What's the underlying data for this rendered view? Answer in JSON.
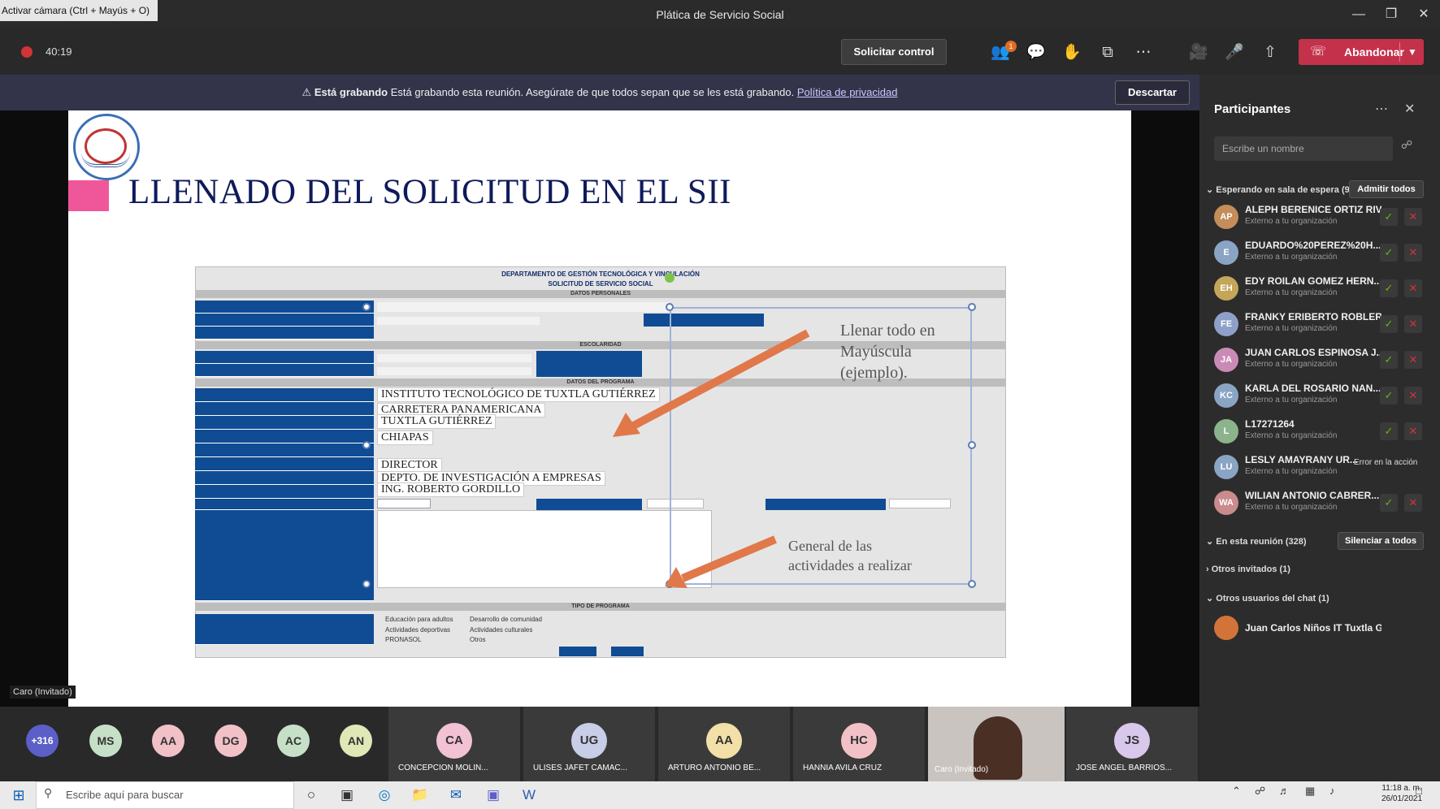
{
  "window": {
    "camera_tooltip": "Activar cámara (Ctrl + Mayús + O)",
    "title": "Plática de Servicio Social",
    "minimize": "—",
    "maximize": "❐",
    "close": "✕"
  },
  "toolbar": {
    "timer": "40:19",
    "request_control": "Solicitar control",
    "notification_count": "1",
    "leave_label": "Abandonar"
  },
  "banner": {
    "bold": "Está grabando",
    "text": " Está grabando esta reunión. Asegúrate de que todos sepan que se les está grabando.",
    "link": "Política de privacidad",
    "discard": "Descartar"
  },
  "slide": {
    "title": "LLENADO DEL SOLICITUD EN EL SII",
    "annotation_1_line1": "Llenar todo en",
    "annotation_1_line2": "Mayúscula",
    "annotation_1_line3": "(ejemplo).",
    "annotation_2_line1": "General de las",
    "annotation_2_line2": "actividades a realizar",
    "form": {
      "header1": "DEPARTAMENTO DE GESTIÓN TECNOLÓGICA Y VINCULACIÓN",
      "header2": "SOLICITUD DE SERVICIO SOCIAL",
      "bar_personal": "DATOS PERSONALES",
      "bar_school": "ESCOLARIDAD",
      "bar_program": "DATOS DEL PROGRAMA",
      "bar_type": "TIPO DE PROGRAMA",
      "val_program_entity": "INSTITUTO TECNOLÓGICO DE TUXTLA GUTIÉRREZ",
      "val_address": "CARRETERA PANAMERICANA",
      "val_city": "TUXTLA GUTIÉRREZ",
      "val_state": "CHIAPAS",
      "val_position": "DIRECTOR",
      "val_dept": "DEPTO. DE INVESTIGACIÓN A EMPRESAS",
      "val_responsible": "ING. ROBERTO GORDILLO",
      "type_opts": [
        "Educación para adultos",
        "Desarrollo de comunidad",
        "Actividades deportivas",
        "Actividades culturales",
        "PRONASOL",
        "Otros"
      ]
    }
  },
  "presenter_tag": "Caro (Invitado)",
  "participants": {
    "title": "Participantes",
    "search_placeholder": "Escribe un nombre",
    "waiting_label": "Esperando en sala de espera (9)",
    "admit_all": "Admitir todos",
    "in_meeting_label": "En esta reunión (328)",
    "mute_all": "Silenciar a todos",
    "other_invited": "Otros invitados (1)",
    "other_chat": "Otros usuarios del chat (1)",
    "external_note": "Externo a tu organización",
    "action_error": "Error en la acción",
    "waiting": [
      {
        "initials": "AP",
        "name": "ALEPH BERENICE ORTIZ RIV...",
        "color": "#c48d5a"
      },
      {
        "initials": "E",
        "name": "EDUARDO%20PEREZ%20H...",
        "color": "#8aa4c4"
      },
      {
        "initials": "EH",
        "name": "EDY ROILAN GOMEZ HERN...",
        "color": "#c4a65a"
      },
      {
        "initials": "FE",
        "name": "FRANKY ERIBERTO ROBLER...",
        "color": "#8ea0c9"
      },
      {
        "initials": "JA",
        "name": "JUAN CARLOS ESPINOSA J...",
        "color": "#c98bb6"
      },
      {
        "initials": "KC",
        "name": "KARLA DEL ROSARIO NAN...",
        "color": "#8aa4c4"
      },
      {
        "initials": "L",
        "name": "L17271264",
        "color": "#8cb48c"
      },
      {
        "initials": "LU",
        "name": "LESLY AMAYRANY UR...",
        "color": "#8aa4c4"
      },
      {
        "initials": "WA",
        "name": "WILIAN ANTONIO CABRER...",
        "color": "#c98b8b"
      }
    ],
    "chat_user": "Juan Carlos Niños IT Tuxtla Gtz"
  },
  "gallery": {
    "overflow": "+316",
    "avatars": [
      {
        "initials": "MS",
        "color": "#c6e0c8"
      },
      {
        "initials": "AA",
        "color": "#f2c1c7"
      },
      {
        "initials": "DG",
        "color": "#f2c1c7"
      },
      {
        "initials": "AC",
        "color": "#c6e0c8"
      },
      {
        "initials": "AN",
        "color": "#e0e8b8"
      }
    ],
    "tiles": [
      {
        "initials": "CA",
        "name": "CONCEPCION MOLIN...",
        "color": "#f2c1d4"
      },
      {
        "initials": "UG",
        "name": "ULISES JAFET CAMAC...",
        "color": "#c8cde8"
      },
      {
        "initials": "AA",
        "name": "ARTURO ANTONIO BE...",
        "color": "#f2e0a8"
      },
      {
        "initials": "HC",
        "name": "HANNIA AVILA CRUZ",
        "color": "#f2c1c7"
      },
      {
        "initials": "JS",
        "name": "JOSE ANGEL BARRIOS...",
        "color": "#d8c8ec"
      }
    ],
    "video_name": "Caro (Invitado)"
  },
  "taskbar": {
    "search_placeholder": "Escribe aquí para buscar",
    "time": "11:18 a. m.",
    "date": "26/01/2021"
  }
}
